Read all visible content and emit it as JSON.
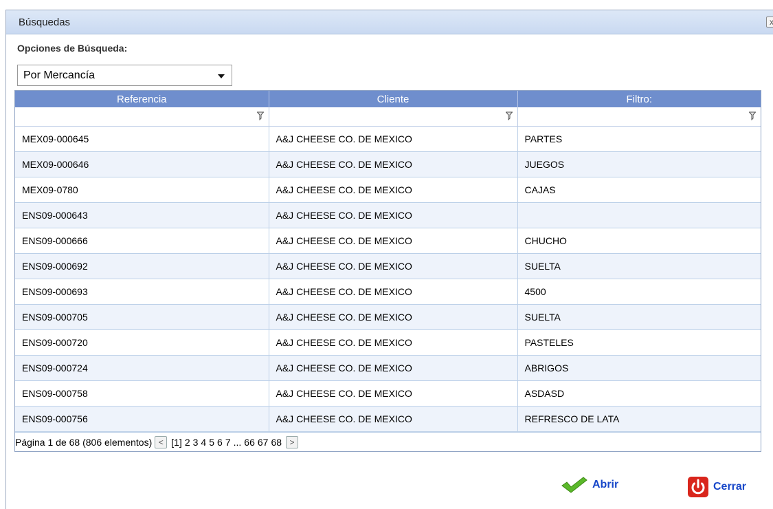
{
  "dialog": {
    "title": "Búsquedas",
    "close_label": "x"
  },
  "search_options": {
    "label": "Opciones de Búsqueda:",
    "selected": "Por Mercancía"
  },
  "grid": {
    "columns": [
      "Referencia",
      "Cliente",
      "Filtro:"
    ],
    "rows": [
      [
        "MEX09-000645",
        "A&J CHEESE CO. DE MEXICO",
        "PARTES"
      ],
      [
        "MEX09-000646",
        "A&J CHEESE CO. DE MEXICO",
        "JUEGOS"
      ],
      [
        "MEX09-0780",
        "A&J CHEESE CO. DE MEXICO",
        "CAJAS"
      ],
      [
        "ENS09-000643",
        "A&J CHEESE CO. DE MEXICO",
        ""
      ],
      [
        "ENS09-000666",
        "A&J CHEESE CO. DE MEXICO",
        "CHUCHO"
      ],
      [
        "ENS09-000692",
        "A&J CHEESE CO. DE MEXICO",
        "SUELTA"
      ],
      [
        "ENS09-000693",
        "A&J CHEESE CO. DE MEXICO",
        "4500"
      ],
      [
        "ENS09-000705",
        "A&J CHEESE CO. DE MEXICO",
        "SUELTA"
      ],
      [
        "ENS09-000720",
        "A&J CHEESE CO. DE MEXICO",
        "PASTELES"
      ],
      [
        "ENS09-000724",
        "A&J CHEESE CO. DE MEXICO",
        "ABRIGOS"
      ],
      [
        "ENS09-000758",
        "A&J CHEESE CO. DE MEXICO",
        "ASDASD"
      ],
      [
        "ENS09-000756",
        "A&J CHEESE CO. DE MEXICO",
        "REFRESCO DE LATA"
      ]
    ]
  },
  "pager": {
    "summary": "Página 1 de 68 (806 elementos)",
    "current": "[1]",
    "pages": [
      "2",
      "3",
      "4",
      "5",
      "6",
      "7",
      "...",
      "66",
      "67",
      "68"
    ],
    "prev_icon": "chevron-left-icon",
    "next_icon": "chevron-right-icon"
  },
  "actions": {
    "open_label": "Abrir",
    "close_label": "Cerrar"
  },
  "colors": {
    "header_bg": "#6f8ecd",
    "alt_row": "#eef3fb",
    "action_text": "#1747c9",
    "open_icon": "#5bb82a",
    "close_icon": "#d9261c"
  }
}
